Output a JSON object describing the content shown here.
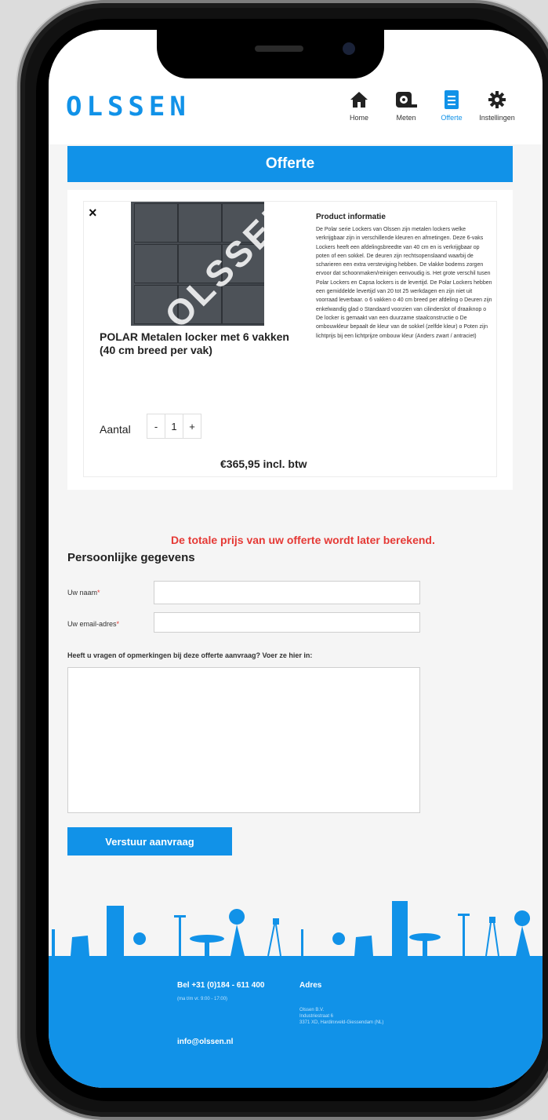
{
  "app": {
    "logo": "OLSSEN",
    "brand_color": "#1192e8"
  },
  "nav": [
    {
      "label": "Home",
      "icon": "home-icon"
    },
    {
      "label": "Meten",
      "icon": "tape-measure-icon"
    },
    {
      "label": "Offerte",
      "icon": "document-icon",
      "active": true
    },
    {
      "label": "Instellingen",
      "icon": "gear-icon"
    }
  ],
  "page": {
    "title": "Offerte"
  },
  "product": {
    "close": "×",
    "watermark": "OLSSEN",
    "name": "POLAR Metalen locker met 6 vakken (40 cm breed per vak)",
    "info_title": "Product informatie",
    "info_text": "De Polar serie Lockers van Olssen zijn metalen lockers welke verkrijgbaar zijn in verschillende kleuren en afmetingen. Deze 6-vaks Lockers heeft een afdelingsbreedte van 40 cm en is verkrijgbaar op poten of een sokkel. De deuren zijn rechtsopenslaand waarbij de scharieren een extra versteviging hebben. De vlakke bodems zorgen ervoor dat schoonmaken/reinigen eenvoudig is. Het grote verschil tusen Polar Lockers en Capsa lockers is de levertijd. De Polar Lockers hebben een gemiddelde levertijd van 20 tot 25 werkdagen en zijn niet uit voorraad leverbaar. o 6 vakken o 40 cm breed per afdeling o Deuren zijn enkelwandig glad o Standaard voorzien van cilinderslot of draaiknop o De locker is gemaakt van een duurzame staalconstructie o De ombouwkleur bepaalt de kleur van de sokkel (zelfde kleur) o Poten zijn lichtprijs bij een lichtprijze ombouw kleur (Anders zwart / antraciet)",
    "qty_label": "Aantal",
    "qty_minus": "-",
    "qty_value": "1",
    "qty_plus": "+",
    "price": "€365,95 incl. btw"
  },
  "form": {
    "notice": "De totale prijs van uw offerte wordt later berekend.",
    "section_title": "Persoonlijke gegevens",
    "name_label": "Uw naam",
    "email_label": "Uw email-adres",
    "required_mark": "*",
    "question_label": "Heeft u vragen of opmerkingen bij deze offerte aanvraag? Voer ze hier in:",
    "submit_label": "Verstuur aanvraag"
  },
  "footer": {
    "phone": "Bel +31 (0)184 - 611 400",
    "hours": "(ma t/m vr. 9:00 - 17:00)",
    "email": "info@olssen.nl",
    "address_title": "Adres",
    "address_lines": [
      "Olssen B.V.",
      "Industriestraat 6",
      "3371 XD, Hardinxveld-Giessendam (NL)"
    ]
  }
}
